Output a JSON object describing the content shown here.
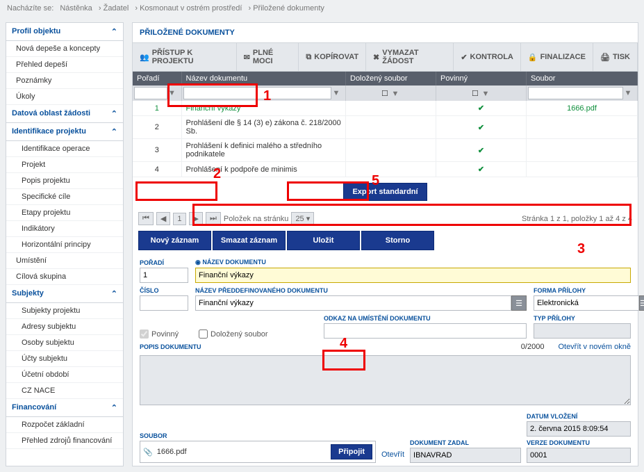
{
  "breadcrumb": {
    "label": "Nacházíte se:",
    "items": [
      "Nástěnka",
      "Žadatel",
      "Kosmonaut v ostrém prostředí",
      "Přiložené dokumenty"
    ]
  },
  "sidebar": {
    "groups": [
      {
        "title": "Profil objektu",
        "items": [
          "Nová depeše a koncepty",
          "Přehled depeší",
          "Poznámky",
          "Úkoly"
        ]
      },
      {
        "title": "Datová oblast žádosti",
        "items": []
      },
      {
        "title": "Identifikace projektu",
        "items": [
          "Identifikace operace",
          "Projekt",
          "Popis projektu",
          "Specifické cíle",
          "Etapy projektu",
          "Indikátory",
          "Horizontální principy"
        ]
      },
      {
        "title": "",
        "plain": [
          "Umístění",
          "Cílová skupina"
        ]
      },
      {
        "title": "Subjekty",
        "items": [
          "Subjekty projektu",
          "Adresy subjektu",
          "Osoby subjektu",
          "Účty subjektu",
          "Účetní období",
          "CZ NACE"
        ]
      },
      {
        "title": "Financování",
        "items": [
          "Rozpočet základní",
          "Přehled zdrojů financování"
        ]
      }
    ]
  },
  "panelTitle": "PŘILOŽENÉ DOKUMENTY",
  "toolbar": [
    "PŘÍSTUP K PROJEKTU",
    "PLNÉ MOCI",
    "KOPÍROVAT",
    "VYMAZAT ŽÁDOST",
    "KONTROLA",
    "FINALIZACE",
    "TISK"
  ],
  "grid": {
    "headers": [
      "Pořadí",
      "Název dokumentu",
      "Doložený soubor",
      "Povinný",
      "Soubor"
    ],
    "rows": [
      {
        "n": "1",
        "name": "Finanční výkazy",
        "dol": false,
        "pov": true,
        "file": "1666.pdf",
        "sel": true
      },
      {
        "n": "2",
        "name": "Prohlášení dle § 14 (3) e) zákona č. 218/2000 Sb.",
        "dol": false,
        "pov": true,
        "file": ""
      },
      {
        "n": "3",
        "name": "Prohlášení k definici malého a středního podnikatele",
        "dol": false,
        "pov": true,
        "file": ""
      },
      {
        "n": "4",
        "name": "Prohlášení k podpoře de minimis",
        "dol": false,
        "pov": true,
        "file": ""
      }
    ],
    "export": "Export standardní",
    "pagerLabel": "Položek na stránku",
    "pagerVal": "25",
    "pagerInfo": "Stránka 1 z 1, položky 1 až 4 z 4"
  },
  "buttons": {
    "new": "Nový záznam",
    "del": "Smazat záznam",
    "save": "Uložit",
    "cancel": "Storno"
  },
  "form": {
    "poradi": {
      "label": "POŘADÍ",
      "value": "1"
    },
    "nazev": {
      "label": "NÁZEV DOKUMENTU",
      "value": "Finanční výkazy"
    },
    "cislo": {
      "label": "ČÍSLO",
      "value": ""
    },
    "preddef": {
      "label": "NÁZEV PŘEDDEFINOVANÉHO DOKUMENTU",
      "value": "Finanční výkazy"
    },
    "forma": {
      "label": "FORMA PŘÍLOHY",
      "value": "Elektronická"
    },
    "povinny": "Povinný",
    "dolozeny": "Doložený soubor",
    "odkaz": {
      "label": "ODKAZ NA UMÍSTĚNÍ DOKUMENTU",
      "value": ""
    },
    "typ": {
      "label": "TYP PŘÍLOHY",
      "value": ""
    },
    "popis": {
      "label": "POPIS DOKUMENTU",
      "counter": "0/2000",
      "link": "Otevřít v novém okně"
    },
    "soubor": {
      "label": "SOUBOR",
      "value": "1666.pdf",
      "attach": "Připojit",
      "open": "Otevřít"
    },
    "zadal": {
      "label": "DOKUMENT ZADAL",
      "value": "IBNAVRAD"
    },
    "datum": {
      "label": "DATUM VLOŽENÍ",
      "value": "2. června 2015 8:09:54"
    },
    "verze": {
      "label": "VERZE DOKUMENTU",
      "value": "0001"
    }
  },
  "annot": {
    "1": "1",
    "2": "2",
    "3": "3",
    "4": "4",
    "5": "5"
  }
}
